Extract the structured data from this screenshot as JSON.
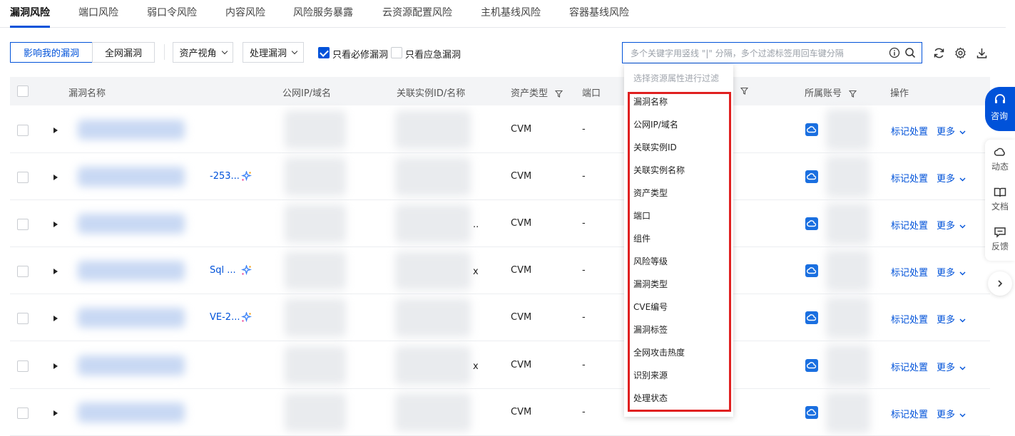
{
  "tabs": [
    "漏洞风险",
    "端口风险",
    "弱口令风险",
    "内容风险",
    "风险服务暴露",
    "云资源配置风险",
    "主机基线风险",
    "容器基线风险"
  ],
  "toolbar": {
    "affect_me": "影响我的漏洞",
    "all_vuln": "全网漏洞",
    "asset_view": "资产视角",
    "handle_vuln": "处理漏洞",
    "must_fix_label": "只看必修漏洞",
    "must_fix_checked": true,
    "emergency_label": "只看应急漏洞",
    "emergency_checked": false
  },
  "search": {
    "placeholder": "多个关键字用竖线 \"|\" 分隔，多个过滤标签用回车键分隔"
  },
  "table": {
    "columns": [
      "漏洞名称",
      "公网IP/域名",
      "关联实例ID/名称",
      "资产类型",
      "端口",
      "所属账号",
      "操作"
    ],
    "rows": [
      {
        "name_suffix": "",
        "asset_type": "CVM",
        "port": "-",
        "instance_suffix": "",
        "action": "标记处置",
        "more": "更多"
      },
      {
        "name_suffix": "-253...",
        "asset_type": "CVM",
        "port": "-",
        "instance_suffix": "",
        "action": "标记处置",
        "more": "更多"
      },
      {
        "name_suffix": "",
        "asset_type": "CVM",
        "port": "-",
        "instance_suffix": "..",
        "action": "标记处置",
        "more": "更多"
      },
      {
        "name_suffix": "Sql ...",
        "asset_type": "CVM",
        "port": "-",
        "instance_suffix": "x",
        "action": "标记处置",
        "more": "更多"
      },
      {
        "name_suffix": "VE-2...",
        "asset_type": "CVM",
        "port": "-",
        "instance_suffix": "",
        "action": "标记处置",
        "more": "更多"
      },
      {
        "name_suffix": "",
        "asset_type": "CVM",
        "port": "-",
        "instance_suffix": "x",
        "action": "标记处置",
        "more": "更多"
      },
      {
        "name_suffix": "",
        "asset_type": "CVM",
        "port": "-",
        "instance_suffix": "",
        "action": "标记处置",
        "more": "更多"
      }
    ]
  },
  "dropdown": {
    "hint": "选择资源属性进行过滤",
    "items": [
      "漏洞名称",
      "公网IP/域名",
      "关联实例ID",
      "关联实例名称",
      "资产类型",
      "端口",
      "组件",
      "风险等级",
      "漏洞类型",
      "CVE编号",
      "漏洞标签",
      "全网攻击热度",
      "识别来源",
      "处理状态"
    ]
  },
  "rail": {
    "consult": "咨询",
    "dynamic": "动态",
    "docs": "文档",
    "feedback": "反馈"
  },
  "colors": {
    "primary": "#0052d9",
    "highlight": "#e02020"
  }
}
